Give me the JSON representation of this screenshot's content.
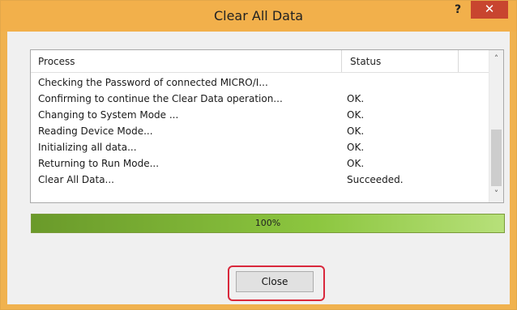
{
  "window": {
    "title": "Clear All Data",
    "help_glyph": "?",
    "close_glyph": "✕"
  },
  "listview": {
    "columns": [
      "Process",
      "Status"
    ],
    "rows": [
      {
        "process": "Checking the Password of connected MICRO/I...",
        "status": ""
      },
      {
        "process": "Confirming to continue the Clear Data operation...",
        "status": "OK."
      },
      {
        "process": "Changing to System Mode ...",
        "status": "OK."
      },
      {
        "process": "Reading Device Mode...",
        "status": "OK."
      },
      {
        "process": "Initializing all data...",
        "status": "OK."
      },
      {
        "process": "Returning to Run Mode...",
        "status": "OK."
      },
      {
        "process": "Clear All Data...",
        "status": "Succeeded."
      }
    ],
    "scroll_up_glyph": "˄",
    "scroll_down_glyph": "˅"
  },
  "progress": {
    "value": 1.0,
    "label": "100%"
  },
  "buttons": {
    "close_label": "Close"
  },
  "colors": {
    "title_bar": "#f2b04b",
    "close_button": "#c8452f",
    "highlight": "#d9283c",
    "progress_green": "#8cc63f"
  }
}
